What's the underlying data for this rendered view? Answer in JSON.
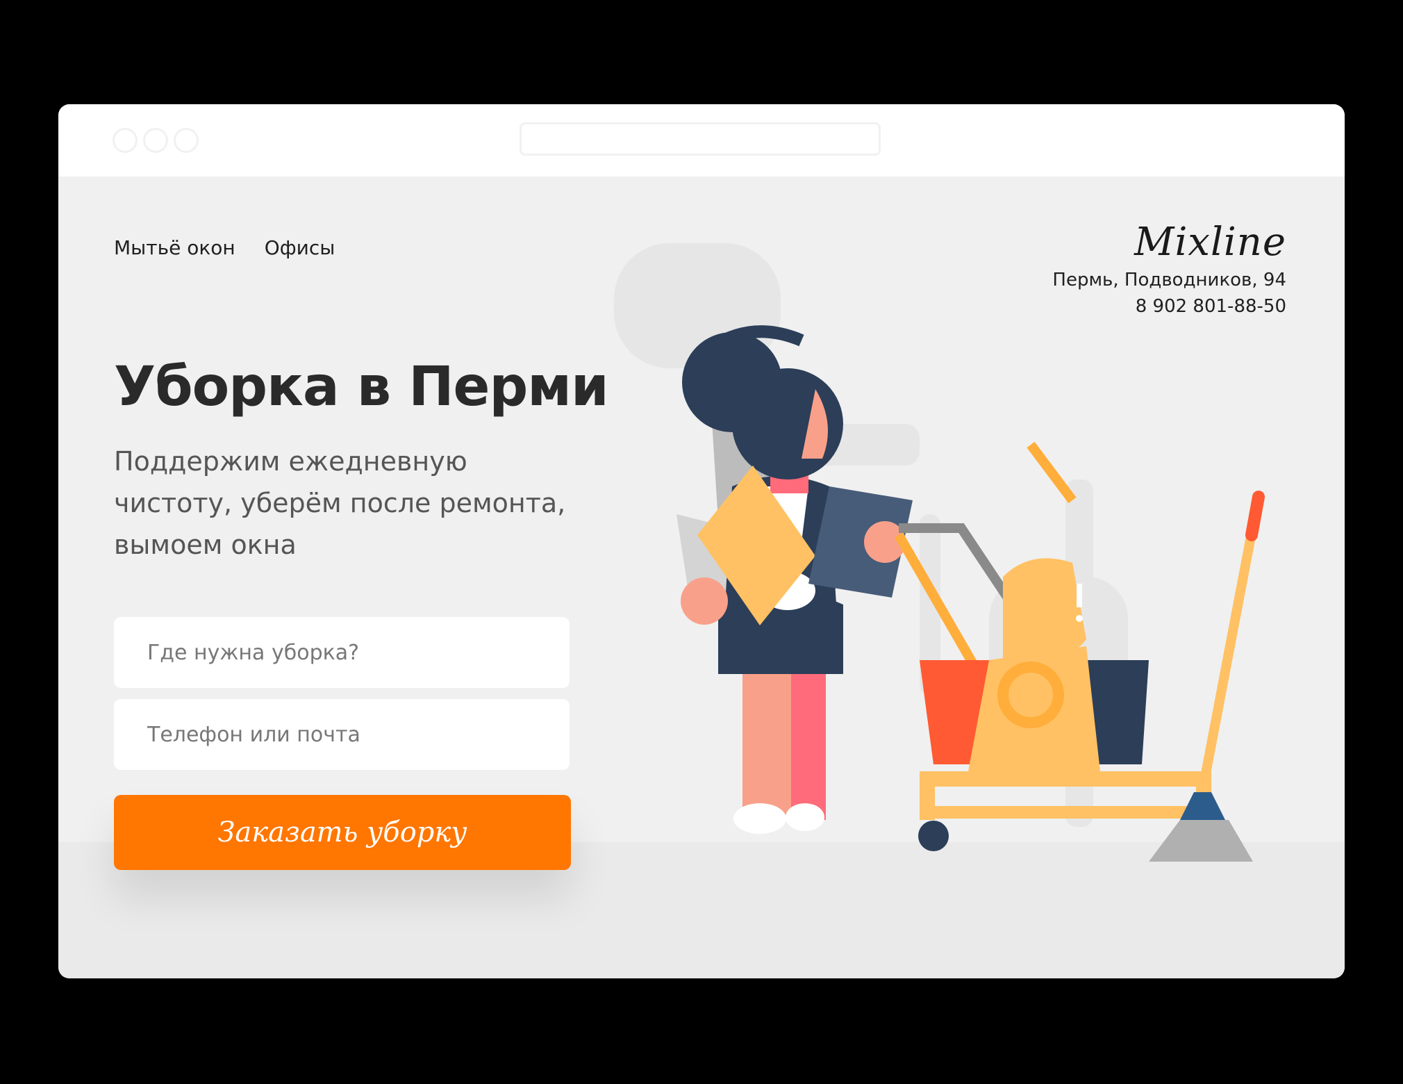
{
  "nav": {
    "items": [
      "Мытьё окон",
      "Офисы"
    ]
  },
  "brand": {
    "logo": "Mixline",
    "address": "Пермь, Подводников, 94",
    "phone": "8 902 801-88-50"
  },
  "hero": {
    "title": "Уборка в Перми",
    "subtitle": "Поддержим ежедневную чистоту, уберём после ремонта, вымоем окна"
  },
  "form": {
    "where_placeholder": "Где нужна уборка?",
    "contact_placeholder": "Телефон или почта",
    "submit_label": "Заказать уборку"
  },
  "colors": {
    "accent": "#ff7600",
    "page_bg": "#f0f0f0",
    "navy": "#2c3e58",
    "skin": "#f9a08a",
    "mustard": "#ffc163",
    "red_bucket": "#ff5a33"
  },
  "illustration": "cleaning-woman-with-cart-and-mop"
}
